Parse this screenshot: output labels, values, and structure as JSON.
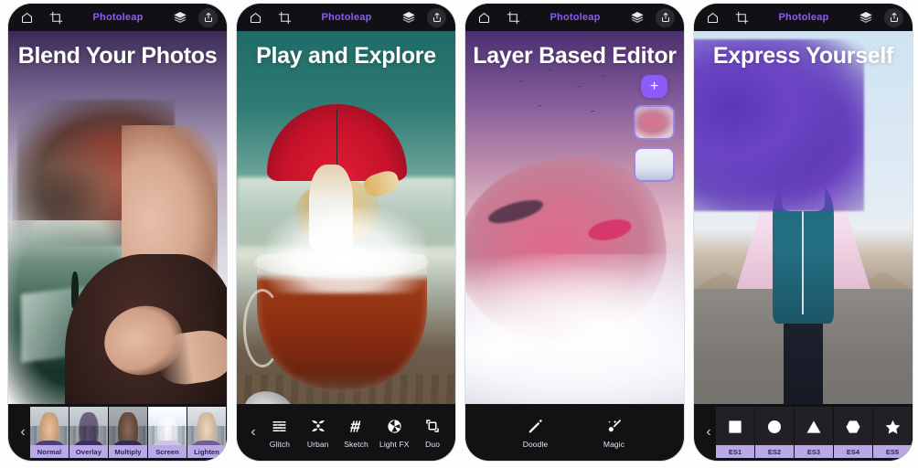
{
  "app": {
    "name": "Photoleap",
    "title_color": "#8b5cf6"
  },
  "screens": [
    {
      "id": "blend",
      "topbar": {
        "home_label": "Home",
        "crop_label": "Crop",
        "title": "Photoleap",
        "layers_label": "Layers",
        "export_label": "Export"
      },
      "headline": "Blend Your Photos",
      "bottom": {
        "type": "blend-modes",
        "back_label": "‹",
        "items": [
          {
            "label": "Normal"
          },
          {
            "label": "Overlay"
          },
          {
            "label": "Multiply"
          },
          {
            "label": "Screen"
          },
          {
            "label": "Lighten"
          }
        ]
      }
    },
    {
      "id": "effects",
      "topbar": {
        "home_label": "Home",
        "crop_label": "Crop",
        "title": "Photoleap",
        "layers_label": "Layers",
        "export_label": "Export"
      },
      "headline": "Play and Explore",
      "bottom": {
        "type": "tools",
        "back_label": "‹",
        "items": [
          {
            "label": "Glitch",
            "icon": "glitch-icon"
          },
          {
            "label": "Urban",
            "icon": "urban-icon"
          },
          {
            "label": "Sketch",
            "icon": "sketch-icon"
          },
          {
            "label": "Light FX",
            "icon": "light-fx-icon"
          },
          {
            "label": "Duo",
            "icon": "duo-icon"
          }
        ]
      }
    },
    {
      "id": "layers",
      "topbar": {
        "home_label": "Home",
        "crop_label": "Crop",
        "title": "Photoleap",
        "layers_label": "Layers",
        "export_label": "Export"
      },
      "headline": "Layer Based Editor",
      "layer_panel": {
        "add_label": "+",
        "layers": [
          {
            "name": "layer-portrait"
          },
          {
            "name": "layer-clouds"
          }
        ]
      },
      "bottom": {
        "type": "tools-two",
        "items": [
          {
            "label": "Doodle",
            "icon": "pencil-icon"
          },
          {
            "label": "Magic",
            "icon": "magic-wand-icon"
          }
        ]
      }
    },
    {
      "id": "shapes",
      "topbar": {
        "home_label": "Home",
        "crop_label": "Crop",
        "title": "Photoleap",
        "layers_label": "Layers",
        "export_label": "Export"
      },
      "headline": "Express Yourself",
      "bottom": {
        "type": "shapes",
        "back_label": "‹",
        "items": [
          {
            "label": "ES1",
            "shape": "square"
          },
          {
            "label": "ES2",
            "shape": "circle"
          },
          {
            "label": "ES3",
            "shape": "triangle"
          },
          {
            "label": "ES4",
            "shape": "hexagon"
          },
          {
            "label": "ES5",
            "shape": "star"
          }
        ]
      }
    }
  ]
}
